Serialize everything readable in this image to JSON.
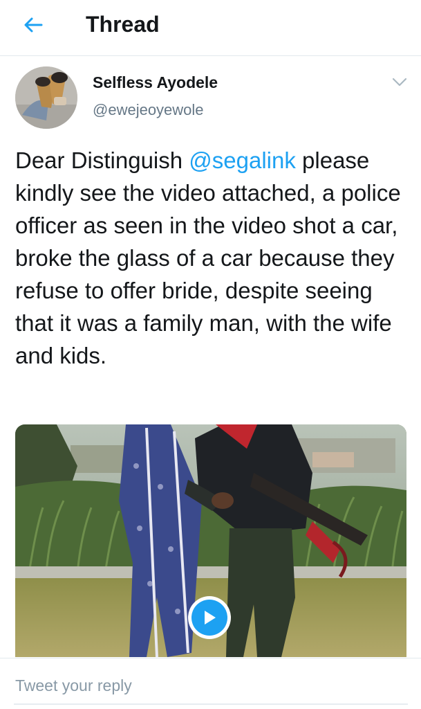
{
  "header": {
    "back_icon": "arrow-left-icon",
    "title": "Thread"
  },
  "tweet": {
    "author": {
      "name": "Selfless Ayodele",
      "handle": "@ewejeoyewole"
    },
    "menu_icon": "chevron-down-icon",
    "text_before_mention": "Dear Distinguish ",
    "mention": "@segalink",
    "text_after_mention": " please kindly see the video attached, a police officer as seen in the video shot a car, broke the glass of a car because they refuse to offer bride, despite seeing that it was a family man, with the wife and kids.",
    "media": {
      "type": "video",
      "play_icon": "play-icon"
    }
  },
  "reply": {
    "placeholder": "Tweet your reply",
    "value": ""
  },
  "colors": {
    "accent": "#1da1f2",
    "text": "#14171a",
    "secondary_text": "#657786",
    "divider": "#e1e8ed"
  }
}
